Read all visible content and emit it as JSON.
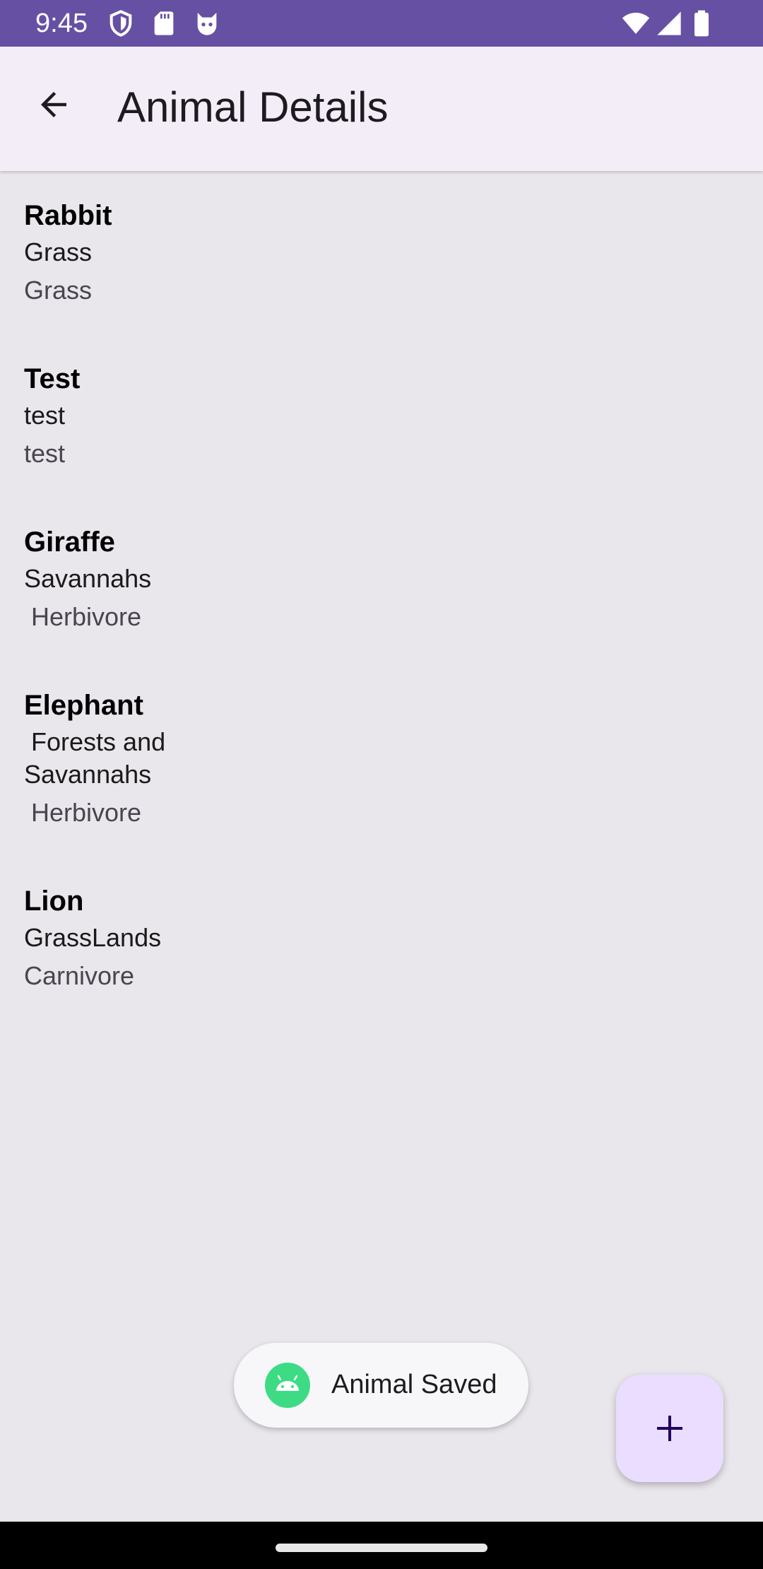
{
  "status_bar": {
    "time": "9:45",
    "left_icons": [
      "shield-icon",
      "sd-card-icon",
      "cat-face-icon"
    ],
    "right_icons": [
      "wifi-icon",
      "cellular-signal-icon",
      "battery-icon"
    ],
    "background": "#6650a4"
  },
  "app_bar": {
    "title": "Animal Details",
    "back_icon": "arrow-back-icon",
    "background": "#f3edf7"
  },
  "animals": [
    {
      "name": "Rabbit",
      "habitat": "Grass",
      "diet": "Grass"
    },
    {
      "name": "Test",
      "habitat": "test",
      "diet": "test"
    },
    {
      "name": "Giraffe",
      "habitat": "Savannahs",
      "diet": " Herbivore"
    },
    {
      "name": "Elephant",
      "habitat": " Forests and Savannahs",
      "diet": " Herbivore"
    },
    {
      "name": "Lion",
      "habitat": "GrassLands",
      "diet": "Carnivore"
    }
  ],
  "toast": {
    "text": "Animal Saved",
    "icon": "android-icon"
  },
  "fab": {
    "icon": "plus-icon",
    "background": "#eaddff"
  },
  "colors": {
    "screen_background": "#e9e6ec",
    "accent": "#6650a4"
  }
}
